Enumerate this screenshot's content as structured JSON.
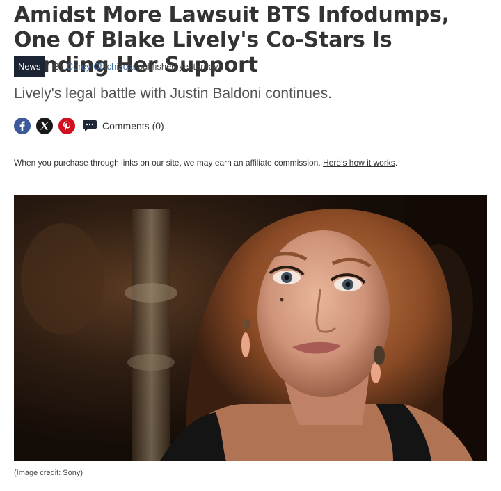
{
  "article": {
    "headline": "Amidst More Lawsuit BTS Infodumps, One Of Blake Lively's Co-Stars Is Sending Her Support",
    "category": "News",
    "byline_prefix": "By",
    "author": "Corey Chichizola",
    "published": "published yesterday",
    "strapline": "Lively's legal battle with Justin Baldoni continues.",
    "share": {
      "facebook_icon": "facebook-icon",
      "x_icon": "x-twitter-icon",
      "pinterest_icon": "pinterest-icon",
      "comments_icon": "comment-bubble-icon",
      "comments_label": "Comments (0)"
    },
    "disclaimer": {
      "text": "When you purchase through links on our site, we may earn an affiliate commission.",
      "link": "Here’s how it works",
      "trailing": "."
    },
    "image": {
      "credit": "(Image credit: Sony)"
    }
  },
  "colors": {
    "tag_background": "#1b2433",
    "author_link": "#3f6ea8",
    "facebook": "#3c5a99",
    "x": "#1a1a1a",
    "pinterest": "#d0101f"
  }
}
